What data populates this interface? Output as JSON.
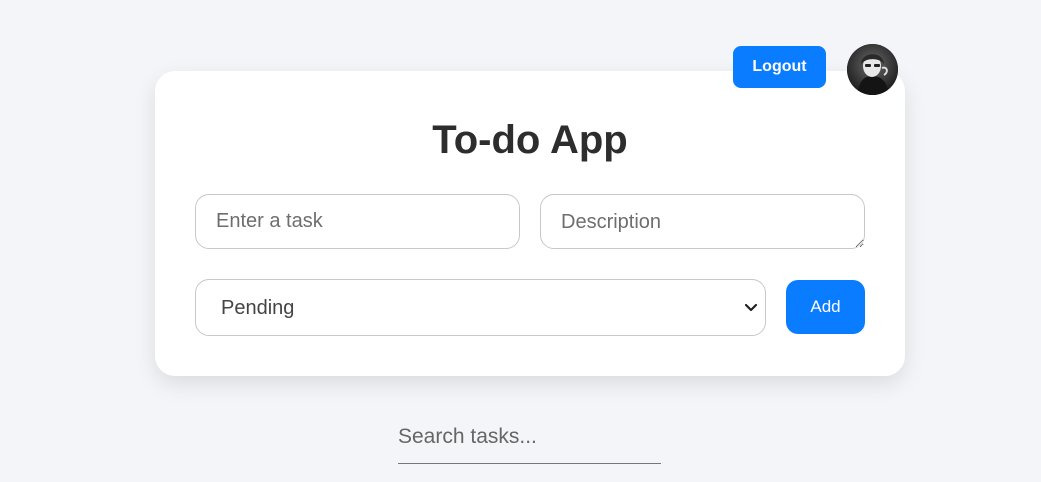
{
  "header": {
    "logout_label": "Logout",
    "avatar_icon": "user-avatar-photo"
  },
  "card": {
    "title": "To-do App",
    "task_input": {
      "placeholder": "Enter a task",
      "value": ""
    },
    "description_input": {
      "placeholder": "Description",
      "value": ""
    },
    "status_select": {
      "selected": "Pending",
      "icon": "chevron-down-icon"
    },
    "add_label": "Add"
  },
  "search": {
    "placeholder": "Search tasks...",
    "value": ""
  },
  "colors": {
    "accent": "#0a7cff",
    "background": "#f4f5f9",
    "card": "#ffffff",
    "title_text": "#2d2d2d"
  }
}
